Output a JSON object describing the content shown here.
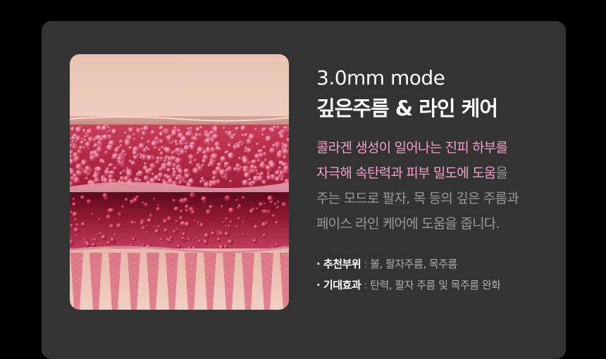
{
  "mode_title": "3.0mm mode",
  "headline": "깊은주름 & 라인 케어",
  "description": {
    "line1": "콜라겐 생성이 일어나는 진피 하부를",
    "line2_highlight": "자극해 속탄력과 피부 밀도에 도움",
    "line2_rest": "을",
    "line3": "주는 모드로 팔자, 목 등의 깊은 주름과",
    "line4": "페이스 라인 케어에 도움을 줍니다."
  },
  "info": {
    "recommended_label": "· 추천부위",
    "recommended_value": "볼, 팔자주름, 목주름",
    "effect_label": "· 기대효과",
    "effect_value": "탄력, 팔자 주름 및 목주름 완화",
    "separator": " : "
  },
  "colors": {
    "background": "#000000",
    "card": "#333333",
    "highlight": "#f2a2c6",
    "body_text": "#9a9a9a"
  }
}
